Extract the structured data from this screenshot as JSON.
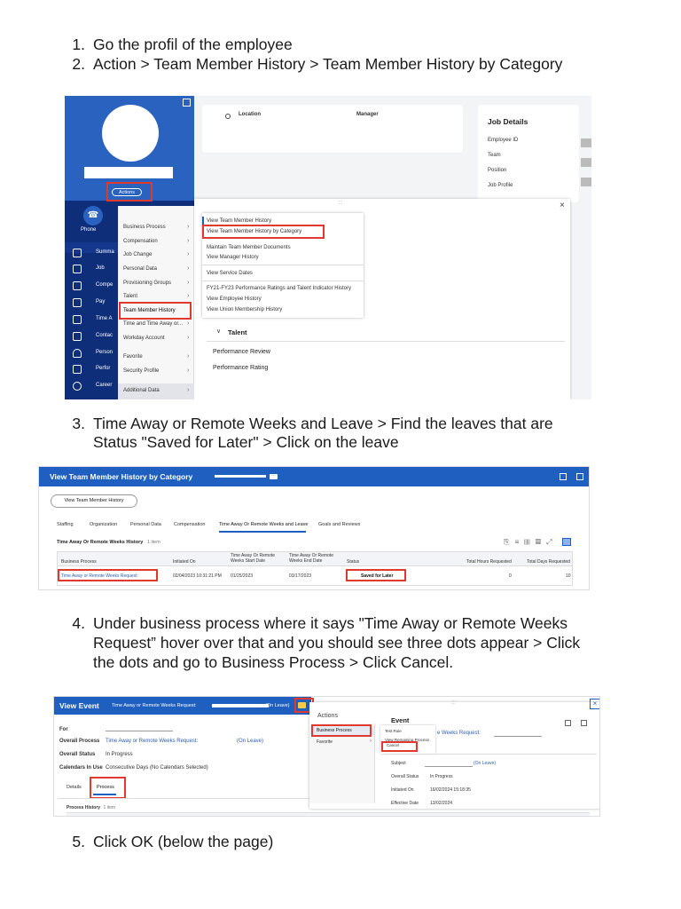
{
  "steps": [
    {
      "num": "1.",
      "lines": [
        "Go the profil of the employee"
      ]
    },
    {
      "num": "2.",
      "lines": [
        "Action > Team Member History > Team Member History by Category"
      ]
    },
    {
      "num": "3.",
      "lines": [
        "Time Away or Remote Weeks and Leave > Find the leaves that are",
        "Status \"Saved for Later\" > Click on the leave"
      ]
    },
    {
      "num": "4.",
      "lines": [
        "Under business process where it says \"Time Away or Remote Weeks",
        "Request” hover over that and you should see three dots appear > Click",
        "the dots and go to Business Process > Click Cancel."
      ]
    },
    {
      "num": "5.",
      "lines": [
        "Click OK (below the page)"
      ]
    }
  ],
  "shot1": {
    "actions_label": "Actions",
    "phone_label": "Phone",
    "location_label": "Location",
    "manager_label": "Manager",
    "job_details_title": "Job Details",
    "job_details_fields": [
      "Employee ID",
      "Team",
      "Position",
      "Job Profile"
    ],
    "nav_items": [
      "Summa",
      "Job",
      "Compe",
      "Pay",
      "Time A",
      "Contac",
      "Person",
      "Perfor",
      "Career"
    ],
    "menu_items": [
      "Business Process",
      "Compensation",
      "Job Change",
      "Personal Data",
      "Provisioning Groups",
      "Talent",
      "Team Member History",
      "Time and Time Away or...",
      "Workday Account",
      "Favorite",
      "Security Profile",
      "Additional Data"
    ],
    "submenu_items": [
      "View Team Member History",
      "View Team Member History by Category",
      "Maintain Team Member Documents",
      "View Manager History",
      "View Service Dates",
      "FY21-FY23 Performance Ratings and Talent Indicator History",
      "View Employee History",
      "View Union Membership History"
    ],
    "talent_section": "Talent",
    "talent_items": [
      "Performance Review",
      "Performance Rating"
    ],
    "close_glyph": "×"
  },
  "shot2": {
    "title": "View Team Member History by Category",
    "button": "View Team Member History",
    "tabs": [
      "Staffing",
      "Organization",
      "Personal Data",
      "Compensation",
      "Time Away Or Remote Weeks and Leave",
      "Goals and Reviews"
    ],
    "table_title": "Time Away Or Remote Weeks History",
    "item_count": "1 item",
    "columns": [
      "Business Process",
      "Initiated On",
      "Time Away Or Remote Weeks Start Date",
      "Time Away Or Remote Weeks End Date",
      "Status",
      "Total Hours Requested",
      "Total Days Requested"
    ],
    "row": [
      "Time Away or Remote Weeks Request:",
      "02/04/2023 10:31:21 PM",
      "01/25/2023",
      "03/17/2023",
      "Saved for Later",
      "0",
      "10"
    ]
  },
  "shot3": {
    "title": "View Event",
    "subtitle": "Time Away or Remote Weeks Request:",
    "on_leave": "(On Leave)",
    "fields": [
      {
        "label": "For",
        "value": ""
      },
      {
        "label": "Overall Process",
        "value": "Time Away or Remote Weeks Request:"
      },
      {
        "label": "Overall Status",
        "value": "In Progress"
      },
      {
        "label": "Calendars In Use",
        "value": "Consecutive Days (No Calendars Selected)"
      }
    ],
    "process_on_leave": "(On Leave)",
    "tabs": [
      "Details",
      "Process"
    ],
    "process_history": "Process History",
    "process_count": "1 item",
    "actions_title": "Actions",
    "actions_items": [
      "Business Process",
      "Favorite"
    ],
    "sub_items": [
      "Test Rule",
      "View Remaining Process",
      "Cancel"
    ],
    "event_title": "Event",
    "event_link": "e Weeks Request:",
    "event_fields": [
      {
        "label": "Subject",
        "value": "(On Leave)"
      },
      {
        "label": "Overall Status",
        "value": "In Progress"
      },
      {
        "label": "Initiated On",
        "value": "16/02/2024 15:18:35"
      },
      {
        "label": "Effective Date",
        "value": "13/02/2024"
      }
    ]
  }
}
